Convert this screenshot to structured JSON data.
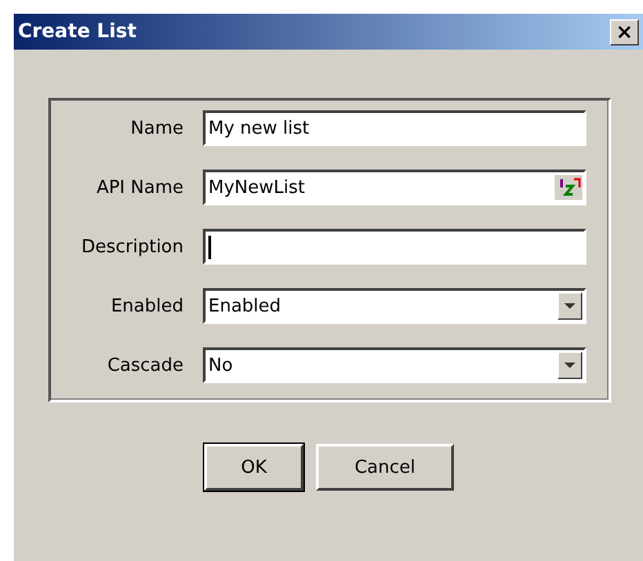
{
  "window": {
    "title": "Create List",
    "close": "×"
  },
  "fields": [
    {
      "label": "Name",
      "kind": "text",
      "value": "My new list",
      "focused": false
    },
    {
      "label": "API Name",
      "kind": "text-icon",
      "value": "MyNewList",
      "focused": false
    },
    {
      "label": "Description",
      "kind": "text",
      "focused": true
    },
    {
      "label": "Enabled",
      "kind": "select",
      "value": "Enabled"
    },
    {
      "label": "Cascade",
      "kind": "select",
      "value": "No"
    }
  ],
  "buttons": [
    {
      "label": "OK",
      "default": true
    },
    {
      "label": "Cancel",
      "default": false
    }
  ]
}
